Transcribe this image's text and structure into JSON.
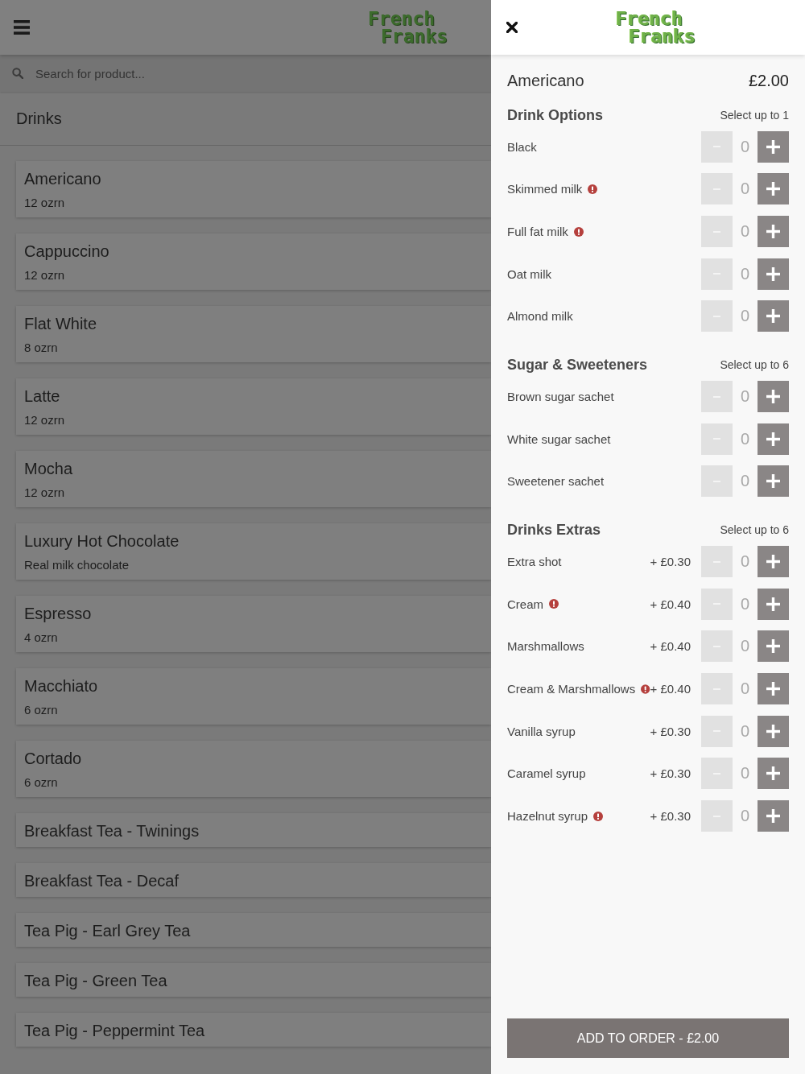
{
  "background_page": {
    "header": {
      "logo": [
        "French",
        "Franks"
      ]
    },
    "search": {
      "placeholder": "Search for product..."
    },
    "category": "Drinks",
    "products": [
      {
        "name": "Americano",
        "detail": "12 ozrn"
      },
      {
        "name": "Cappuccino",
        "detail": "12 ozrn"
      },
      {
        "name": "Flat White",
        "detail": "8 ozrn"
      },
      {
        "name": "Latte",
        "detail": "12 ozrn"
      },
      {
        "name": "Mocha",
        "detail": "12 ozrn"
      },
      {
        "name": "Luxury Hot Chocolate",
        "detail": "Real milk chocolate"
      },
      {
        "name": "Espresso",
        "detail": "4 ozrn"
      },
      {
        "name": "Macchiato",
        "detail": "6 ozrn"
      },
      {
        "name": "Cortado",
        "detail": "6 ozrn"
      },
      {
        "name": "Breakfast Tea - Twinings"
      },
      {
        "name": "Breakfast Tea - Decaf"
      },
      {
        "name": "Tea Pig - Earl Grey Tea"
      },
      {
        "name": "Tea Pig - Green Tea"
      },
      {
        "name": "Tea Pig - Peppermint Tea"
      }
    ]
  },
  "product_panel": {
    "header": {
      "logo": [
        "French",
        "Franks"
      ]
    },
    "product": {
      "name": "Americano",
      "price": "£2.00"
    },
    "groups": [
      {
        "title": "Drink Options",
        "limit": "Select up to 1",
        "options": [
          {
            "name": "Black",
            "warning": false,
            "count": "0",
            "minus_disabled": true
          },
          {
            "name": "Skimmed milk",
            "warning": true,
            "count": "0",
            "minus_disabled": true
          },
          {
            "name": "Full fat milk",
            "warning": true,
            "count": "0",
            "minus_disabled": true
          },
          {
            "name": "Oat milk",
            "warning": false,
            "count": "0",
            "minus_disabled": true
          },
          {
            "name": "Almond milk",
            "warning": false,
            "count": "0",
            "minus_disabled": true
          }
        ]
      },
      {
        "title": "Sugar & Sweeteners",
        "limit": "Select up to 6",
        "options": [
          {
            "name": "Brown sugar sachet",
            "warning": false,
            "count": "0",
            "minus_disabled": true
          },
          {
            "name": "White sugar sachet",
            "warning": false,
            "count": "0",
            "minus_disabled": true
          },
          {
            "name": "Sweetener sachet",
            "warning": false,
            "count": "0",
            "minus_disabled": true
          }
        ]
      },
      {
        "title": "Drinks Extras",
        "limit": "Select up to 6",
        "options": [
          {
            "name": "Extra shot",
            "warning": false,
            "price": "+ £0.30",
            "count": "0",
            "minus_disabled": true
          },
          {
            "name": "Cream",
            "warning": true,
            "price": "+ £0.40",
            "count": "0",
            "minus_disabled": true
          },
          {
            "name": "Marshmallows",
            "warning": false,
            "price": "+ £0.40",
            "count": "0",
            "minus_disabled": true
          },
          {
            "name": "Cream & Marshmallows",
            "warning": true,
            "price": "+ £0.40",
            "count": "0",
            "minus_disabled": true
          },
          {
            "name": "Vanilla syrup",
            "warning": false,
            "price": "+ £0.30",
            "count": "0",
            "minus_disabled": true
          },
          {
            "name": "Caramel syrup",
            "warning": false,
            "price": "+ £0.30",
            "count": "0",
            "minus_disabled": true
          },
          {
            "name": "Hazelnut syrup",
            "warning": true,
            "price": "+ £0.30",
            "count": "0",
            "minus_disabled": true
          }
        ]
      }
    ],
    "add_button": "ADD TO ORDER - £2.00"
  }
}
